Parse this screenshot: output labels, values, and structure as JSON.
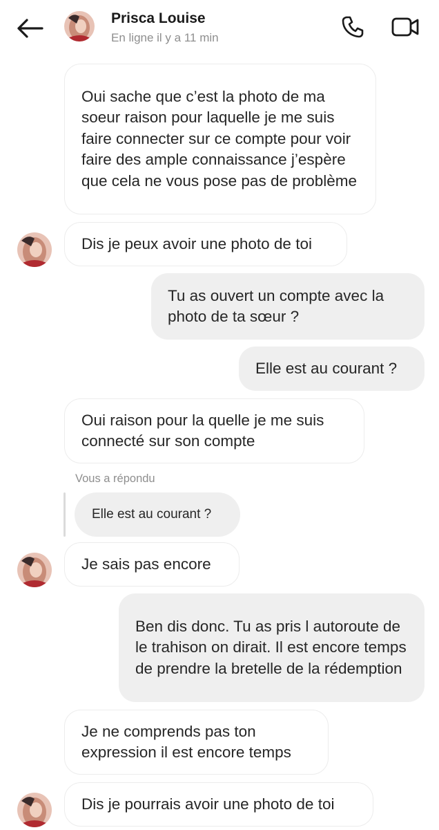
{
  "header": {
    "contact_name": "Prisca Louise",
    "status": "En ligne il y a 11 min",
    "back_icon": "arrow-left-icon",
    "call_icon": "phone-icon",
    "video_icon": "video-camera-icon"
  },
  "messages": [
    {
      "sender": "contact",
      "text": "Oui sache que c’est la photo de ma soeur raison pour laquelle je me suis faire connecter sur ce compte pour voir faire des ample connaissance j’espère que cela ne vous pose pas de problème"
    },
    {
      "sender": "contact",
      "text": "Dis je peux avoir une photo de toi"
    },
    {
      "sender": "me",
      "text": "Tu as ouvert un compte avec la photo de ta sœur ?"
    },
    {
      "sender": "me",
      "text": "Elle est au courant ?"
    },
    {
      "sender": "contact",
      "text": "Oui raison pour la quelle je me suis connecté sur son compte"
    },
    {
      "sender": "contact",
      "text": "Je sais pas encore"
    },
    {
      "sender": "me",
      "text": "Ben dis donc. Tu as pris l autoroute de le trahison on dirait. Il est encore temps de prendre la bretelle de la rédemption"
    },
    {
      "sender": "contact",
      "text": "Je ne comprends pas ton expression il est encore temps"
    },
    {
      "sender": "contact",
      "text": "Dis je pourrais avoir une photo de toi"
    }
  ],
  "reply": {
    "label": "Vous a répondu",
    "quoted_text": "Elle est au courant ?"
  },
  "colors": {
    "outgoing_bubble": "#efefef",
    "incoming_bubble": "#ffffff",
    "incoming_border": "#ececec",
    "muted_text": "#8e8e8e"
  }
}
